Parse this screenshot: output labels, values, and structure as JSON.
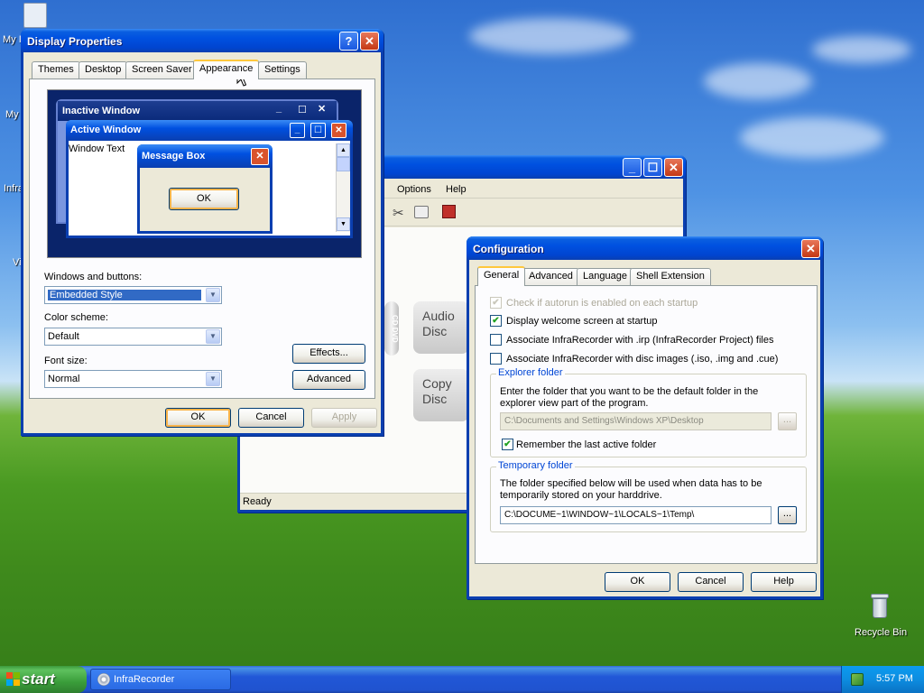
{
  "desktop": {
    "icon_labels": [
      "My I",
      "My",
      "Infra",
      "Vi"
    ],
    "recycle_bin": "Recycle Bin"
  },
  "display_properties": {
    "title": "Display Properties",
    "tabs": [
      "Themes",
      "Desktop",
      "Screen Saver",
      "Appearance",
      "Settings"
    ],
    "active_tab": "Appearance",
    "preview": {
      "inactive_title": "Inactive Window",
      "active_title": "Active Window",
      "window_text": "Window Text",
      "message_box_title": "Message Box",
      "message_ok": "OK"
    },
    "windows_buttons_label": "Windows and buttons:",
    "windows_buttons_value": "Embedded Style",
    "color_scheme_label": "Color scheme:",
    "color_scheme_value": "Default",
    "font_size_label": "Font size:",
    "font_size_value": "Normal",
    "effects_button": "Effects...",
    "advanced_button": "Advanced",
    "ok": "OK",
    "cancel": "Cancel",
    "apply": "Apply"
  },
  "infrarecorder": {
    "menu": [
      "Options",
      "Help"
    ],
    "tiles": [
      "Audio\nDisc",
      "Copy\nDisc"
    ],
    "dvd_label": "CD DVD",
    "status": "Ready"
  },
  "configuration": {
    "title": "Configuration",
    "tabs": [
      "General",
      "Advanced",
      "Language",
      "Shell Extension"
    ],
    "active_tab": "General",
    "options": [
      {
        "label": "Check if autorun is enabled on each startup",
        "checked": true,
        "disabled": true
      },
      {
        "label": "Display welcome screen at startup",
        "checked": true,
        "disabled": false
      },
      {
        "label": "Associate InfraRecorder with .irp (InfraRecorder Project) files",
        "checked": false,
        "disabled": false
      },
      {
        "label": "Associate InfraRecorder with disc images (.iso, .img and .cue)",
        "checked": false,
        "disabled": false
      }
    ],
    "explorer_group": {
      "title": "Explorer folder",
      "description_line1": "Enter the folder that you want to be the default folder in the",
      "description_line2": "explorer view part of the program.",
      "path": "C:\\Documents and Settings\\Windows XP\\Desktop",
      "remember_label": "Remember the last active folder",
      "remember_checked": true
    },
    "temp_group": {
      "title": "Temporary folder",
      "description_line1": "The folder specified below will be used when data has to be",
      "description_line2": "temporarily stored on your harddrive.",
      "path": "C:\\DOCUME~1\\WINDOW~1\\LOCALS~1\\Temp\\"
    },
    "browse": "...",
    "ok": "OK",
    "cancel": "Cancel",
    "help": "Help"
  },
  "taskbar": {
    "start": "start",
    "task": "InfraRecorder",
    "clock": "5:57 PM"
  },
  "glyphs": {
    "check": "✔",
    "close": "✕",
    "minimize": "_",
    "maximize": "☐",
    "help": "?",
    "dropdown": "▼",
    "scroll_up": "▲",
    "scroll_down": "▼"
  }
}
